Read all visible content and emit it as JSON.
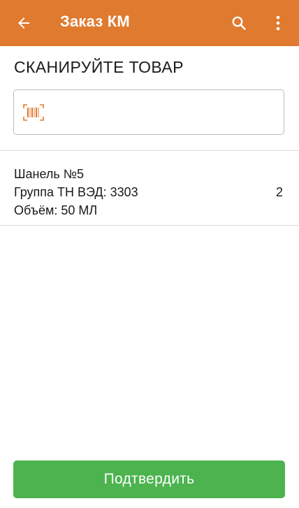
{
  "colors": {
    "appbar": "#e07a2e",
    "confirm_button": "#4cb34f",
    "barcode_icon": "#e07a2e"
  },
  "appbar": {
    "title": "Заказ КМ",
    "back_icon": "arrow-left-icon",
    "search_icon": "search-icon",
    "menu_icon": "more-vertical-icon"
  },
  "screen": {
    "heading": "СКАНИРУЙТЕ ТОВАР"
  },
  "scan_field": {
    "icon": "barcode-icon",
    "value": "",
    "placeholder": ""
  },
  "items": [
    {
      "name": "Шанель №5",
      "group": "Группа ТН ВЭД: 3303",
      "volume": "Объём: 50 МЛ",
      "quantity": "2"
    }
  ],
  "actions": {
    "confirm_label": "Подтвердить"
  }
}
